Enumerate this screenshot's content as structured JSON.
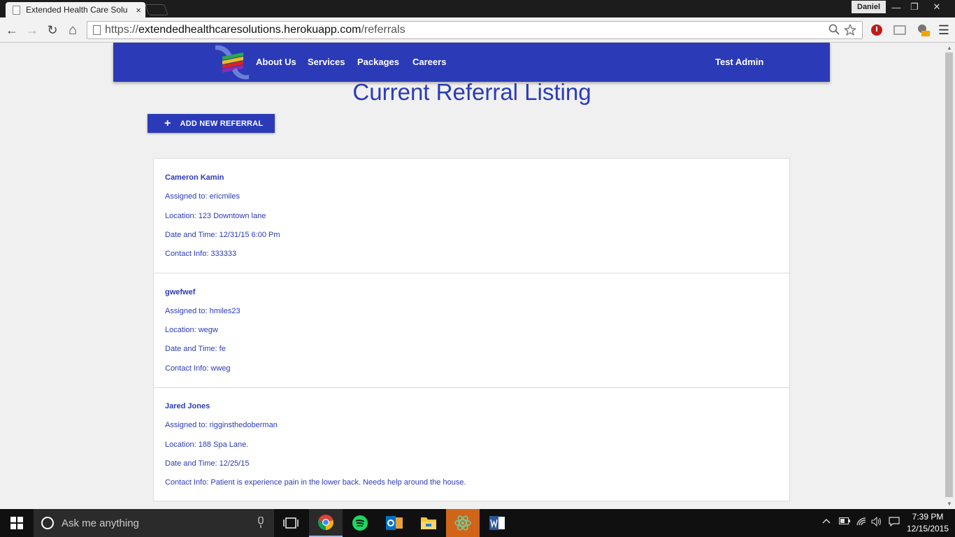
{
  "browser": {
    "tab_title": "Extended Health Care Solu",
    "tab_close": "×",
    "user": "Daniel",
    "url_scheme": "https://",
    "url_host": "extendedhealthcaresolutions.herokuapp.com",
    "url_path": "/referrals",
    "window_controls": {
      "minimize": "—",
      "restore": "❐",
      "close": "✕"
    },
    "nav": {
      "back": "←",
      "forward": "→",
      "reload": "↻",
      "home": "⌂"
    }
  },
  "navbar": {
    "links": [
      "About Us",
      "Services",
      "Packages",
      "Careers"
    ],
    "user": "Test Admin",
    "bg_color": "#2b3bb8"
  },
  "page": {
    "title": "Current Referral Listing",
    "add_button_icon": "+",
    "add_button_label": "ADD NEW REFERRAL"
  },
  "referrals": [
    {
      "name": "Cameron Kamin",
      "assigned": "Assigned to: ericmiles",
      "location": "Location: 123 Downtown lane",
      "datetime": "Date and Time: 12/31/15 6:00 Pm",
      "contact": "Contact Info: 333333"
    },
    {
      "name": "gwefwef",
      "assigned": "Assigned to: hmiles23",
      "location": "Location: wegw",
      "datetime": "Date and Time: fe",
      "contact": "Contact Info: wweg"
    },
    {
      "name": "Jared Jones",
      "assigned": "Assigned to: rigginsthedoberman",
      "location": "Location: 188 Spa Lane.",
      "datetime": "Date and Time: 12/25/15",
      "contact": "Contact Info: Patient is experience pain in the lower back. Needs help around the house."
    }
  ],
  "taskbar": {
    "search_placeholder": "Ask me anything",
    "apps": [
      "task-view-icon",
      "chrome-icon",
      "spotify-icon",
      "outlook-icon",
      "file-explorer-icon",
      "atom-icon",
      "word-icon"
    ],
    "time": "7:39 PM",
    "date": "12/15/2015"
  }
}
